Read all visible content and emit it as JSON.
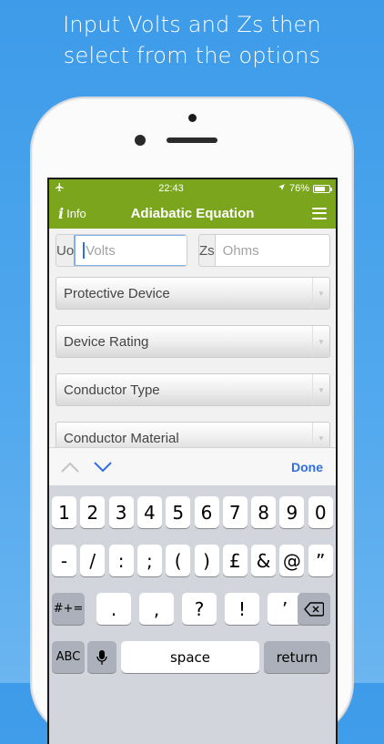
{
  "caption": {
    "line1": "Input Volts and Zs then",
    "line2": "select from the options"
  },
  "status": {
    "time": "22:43",
    "battery_text": "76%",
    "battery_level": 0.76,
    "left_icon": "airplane-icon",
    "location_icon": "location-arrow-icon"
  },
  "navbar": {
    "info_glyph": "i",
    "info_label": "Info",
    "title": "Adiabatic Equation",
    "menu_icon": "hamburger-menu-icon",
    "color": "#7aa51d"
  },
  "inputs": {
    "uo_label": "Uo",
    "uo_placeholder": "Volts",
    "zs_label": "Zs",
    "zs_placeholder": "Ohms"
  },
  "selects": [
    {
      "label": "Protective Device"
    },
    {
      "label": "Device Rating"
    },
    {
      "label": "Conductor Type"
    },
    {
      "label": "Conductor Material"
    }
  ],
  "accessory": {
    "prev_icon": "chevron-up-icon",
    "next_icon": "chevron-down-icon",
    "done_label": "Done",
    "accent": "#2f6ee0"
  },
  "keyboard": {
    "row1": [
      "1",
      "2",
      "3",
      "4",
      "5",
      "6",
      "7",
      "8",
      "9",
      "0"
    ],
    "row2": [
      "-",
      "/",
      ":",
      ";",
      "(",
      ")",
      "£",
      "&",
      "@",
      "”"
    ],
    "row3_mode": "#+=",
    "row3": [
      ".",
      ",",
      "?",
      "!",
      "’"
    ],
    "delete_icon": "backspace-icon",
    "abc_label": "ABC",
    "mic_icon": "microphone-icon",
    "space_label": "space",
    "return_label": "return"
  }
}
